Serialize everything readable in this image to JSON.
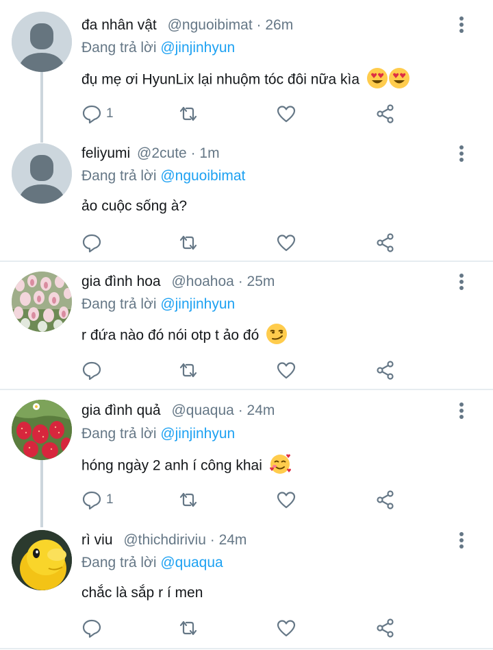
{
  "reply_prefix": "Đang trả lời",
  "tweets": [
    {
      "display_name": "đa nhân vật",
      "handle": "@nguoibimat",
      "time": "26m",
      "reply_to": "@jinjinhyun",
      "text": "đụ mẹ ơi HyunLix lại nhuộm tóc đôi nữa kìa",
      "emoji": [
        "heart-eyes",
        "heart-eyes"
      ],
      "reply_count": "1",
      "avatar": "default-avatar"
    },
    {
      "display_name": "feliyumi",
      "handle": "@2cute",
      "time": "1m",
      "reply_to": "@nguoibimat",
      "text": "ảo cuộc sống à?",
      "emoji": [],
      "reply_count": "",
      "avatar": "default-avatar"
    },
    {
      "display_name": "gia đình hoa",
      "handle": "@hoahoa",
      "time": "25m",
      "reply_to": "@jinjinhyun",
      "text": "r đứa nào đó nói otp t ảo đó",
      "emoji": [
        "smirk"
      ],
      "reply_count": "",
      "avatar": "tulip-photo"
    },
    {
      "display_name": "gia đình quả",
      "handle": "@quaqua",
      "time": "24m",
      "reply_to": "@jinjinhyun",
      "text": "hóng ngày 2 anh í công khai",
      "emoji": [
        "smiling-hearts"
      ],
      "reply_count": "1",
      "avatar": "strawberry-photo"
    },
    {
      "display_name": "rì viu",
      "handle": "@thichdiriviu",
      "time": "24m",
      "reply_to": "@quaqua",
      "text": "chắc là sắp r í men",
      "emoji": [],
      "reply_count": "",
      "avatar": "yellow-creature"
    }
  ],
  "colors": {
    "link": "#1da1f2",
    "muted": "#657786",
    "divider": "#e6ecf0",
    "thread_line": "#ccd6dd"
  }
}
